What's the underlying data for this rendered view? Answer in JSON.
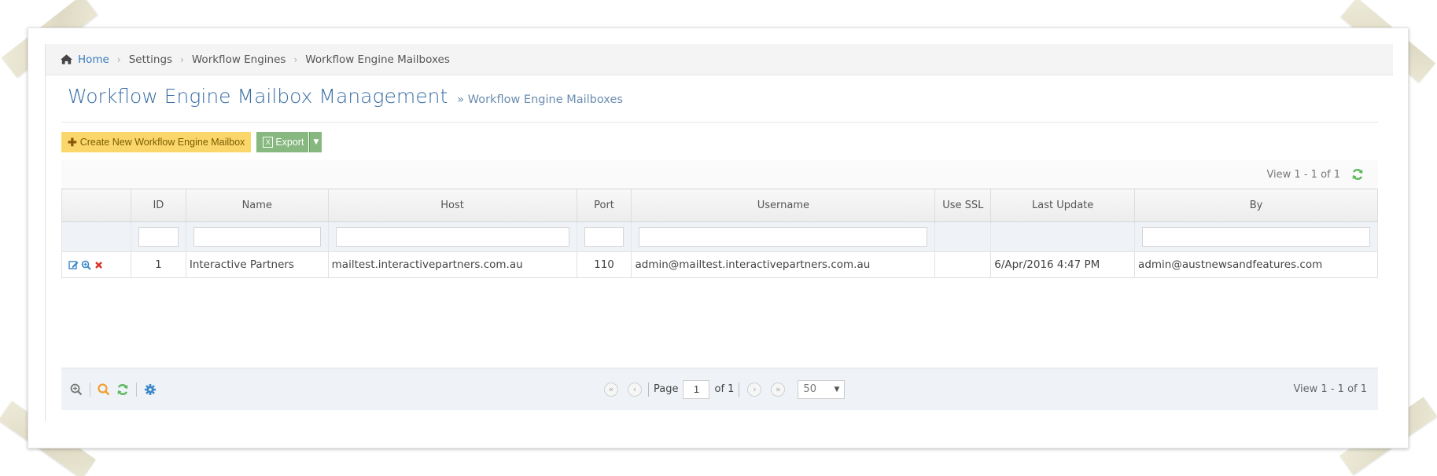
{
  "breadcrumb": {
    "home": "Home",
    "items": [
      "Settings",
      "Workflow Engines",
      "Workflow Engine Mailboxes"
    ],
    "separator": "›"
  },
  "header": {
    "title": "Workflow Engine Mailbox Management",
    "subtitle": "» Workflow Engine Mailboxes"
  },
  "toolbar": {
    "create_label": "Create New Workflow Engine Mailbox",
    "export_label": "Export"
  },
  "grid": {
    "view_info": "View 1 - 1 of 1",
    "columns": [
      "",
      "ID",
      "Name",
      "Host",
      "Port",
      "Username",
      "Use SSL",
      "Last Update",
      "By"
    ],
    "rows": [
      {
        "id": "1",
        "name": "Interactive Partners",
        "host": "mailtest.interactivepartners.com.au",
        "port": "110",
        "username": "admin@mailtest.interactivepartners.com.au",
        "use_ssl": "",
        "last_update": "6/Apr/2016 4:47 PM",
        "by": "admin@austnewsandfeatures.com"
      }
    ]
  },
  "pager": {
    "page_label": "Page",
    "page_value": "1",
    "of_label": "of 1",
    "page_size": "50",
    "view_info": "View 1 - 1 of 1"
  },
  "colors": {
    "title_blue": "#3a6ea5",
    "link_blue": "#3a7bbf",
    "create_yellow": "#fbd76b",
    "export_green": "#87b87f",
    "refresh_green": "#5cb85c",
    "search_orange": "#f0a030",
    "gear_blue": "#3a86c8",
    "delete_red": "#d9302c"
  }
}
